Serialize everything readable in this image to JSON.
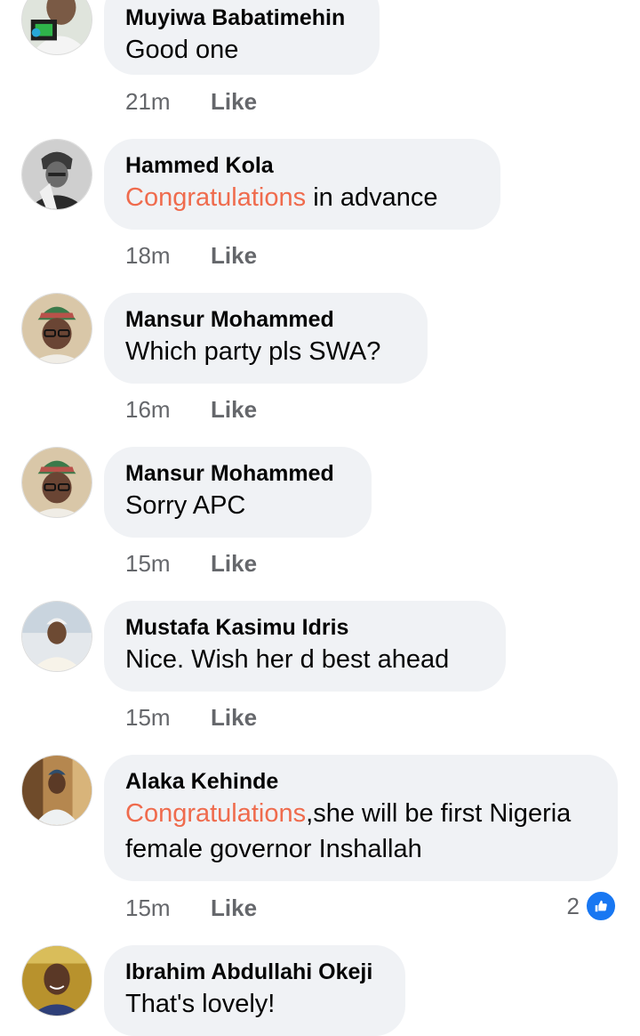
{
  "comments": [
    {
      "author": "Muyiwa Babatimehin",
      "text": "Good one",
      "time": "21m",
      "like": "Like"
    },
    {
      "author": "Hammed Kola",
      "highlight": "Congratulations",
      "text": " in advance",
      "time": "18m",
      "like": "Like"
    },
    {
      "author": "Mansur Mohammed",
      "text": "Which party pls SWA?",
      "time": "16m",
      "like": "Like"
    },
    {
      "author": "Mansur Mohammed",
      "text": "Sorry APC",
      "time": "15m",
      "like": "Like"
    },
    {
      "author": "Mustafa Kasimu Idris",
      "text": "Nice. Wish her d best ahead",
      "time": "15m",
      "like": "Like"
    },
    {
      "author": "Alaka Kehinde",
      "highlight": "Congratulations",
      "text": ",she will be first Nigeria female governor Inshallah",
      "time": "15m",
      "like": "Like",
      "reaction_count": "2"
    },
    {
      "author": "Ibrahim Abdullahi Okeji",
      "text": "That's lovely!"
    }
  ],
  "colors": {
    "bubble": "#f0f2f5",
    "highlight": "#ef6b4d",
    "meta": "#65676b",
    "like_badge": "#1877f2"
  }
}
